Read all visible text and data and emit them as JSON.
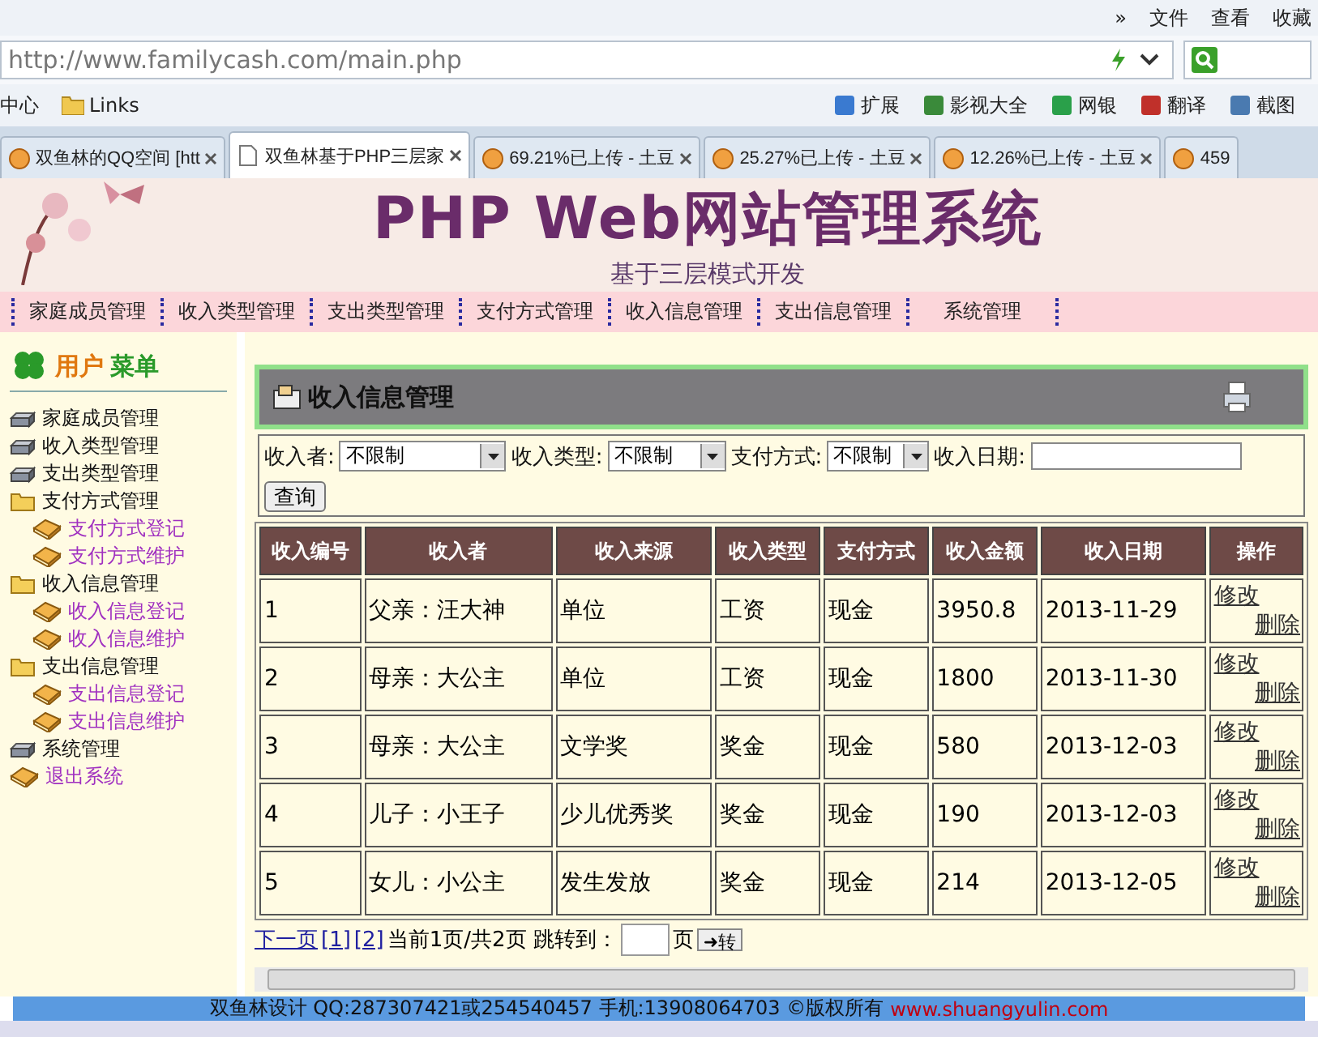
{
  "browser": {
    "menu": [
      "»",
      "文件",
      "查看",
      "收藏"
    ],
    "address": "http://www.familycash.com/main.php",
    "bookmarks_left": [
      "中心",
      "Links"
    ],
    "bookmarks_right": [
      "扩展",
      "影视大全",
      "网银",
      "翻译",
      "截图"
    ],
    "tabs": [
      {
        "label": "双鱼林的QQ空间 [htt",
        "selected": false
      },
      {
        "label": "双鱼林基于PHP三层家",
        "selected": true
      },
      {
        "label": "69.21%已上传 - 土豆",
        "selected": false
      },
      {
        "label": "25.27%已上传 - 土豆",
        "selected": false
      },
      {
        "label": "12.26%已上传 - 土豆",
        "selected": false
      },
      {
        "label": "459",
        "selected": false
      }
    ]
  },
  "header": {
    "title": "PHP Web网站管理系统",
    "subtitle": "基于三层模式开发"
  },
  "nav": [
    "家庭成员管理",
    "收入类型管理",
    "支出类型管理",
    "支付方式管理",
    "收入信息管理",
    "支出信息管理",
    "系统管理"
  ],
  "sidebar": {
    "title_first": "用户",
    "title_second": "菜单",
    "items": [
      {
        "kind": "module",
        "label": "家庭成员管理"
      },
      {
        "kind": "module",
        "label": "收入类型管理"
      },
      {
        "kind": "module",
        "label": "支出类型管理"
      },
      {
        "kind": "folder",
        "label": "支付方式管理",
        "children": [
          {
            "label": "支付方式登记"
          },
          {
            "label": "支付方式维护"
          }
        ]
      },
      {
        "kind": "folder",
        "label": "收入信息管理",
        "children": [
          {
            "label": "收入信息登记"
          },
          {
            "label": "收入信息维护"
          }
        ]
      },
      {
        "kind": "folder",
        "label": "支出信息管理",
        "children": [
          {
            "label": "支出信息登记"
          },
          {
            "label": "支出信息维护"
          }
        ]
      },
      {
        "kind": "module",
        "label": "系统管理"
      },
      {
        "kind": "exit",
        "label": "退出系统"
      }
    ]
  },
  "panel": {
    "title": "收入信息管理",
    "filters": [
      {
        "label": "收入者:",
        "kind": "select",
        "value": "不限制"
      },
      {
        "label": "收入类型:",
        "kind": "select",
        "value": "不限制"
      },
      {
        "label": "支付方式:",
        "kind": "select",
        "value": "不限制"
      },
      {
        "label": "收入日期:",
        "kind": "text"
      }
    ],
    "query_button": "查询",
    "table": {
      "columns": [
        "收入编号",
        "收入者",
        "收入来源",
        "收入类型",
        "支付方式",
        "收入金额",
        "收入日期",
        "操作"
      ],
      "rows": [
        {
          "cells": [
            "1",
            "父亲：汪大神",
            "单位",
            "工资",
            "现金",
            "3950.8",
            "2013-11-29"
          ],
          "actions": [
            "修改",
            "删除"
          ]
        },
        {
          "cells": [
            "2",
            "母亲：大公主",
            "单位",
            "工资",
            "现金",
            "1800",
            "2013-11-30"
          ],
          "actions": [
            "修改",
            "删除"
          ]
        },
        {
          "cells": [
            "3",
            "母亲：大公主",
            "文学奖",
            "奖金",
            "现金",
            "580",
            "2013-12-03"
          ],
          "actions": [
            "修改",
            "删除"
          ]
        },
        {
          "cells": [
            "4",
            "儿子：小王子",
            "少儿优秀奖",
            "奖金",
            "现金",
            "190",
            "2013-12-03"
          ],
          "actions": [
            "修改",
            "删除"
          ]
        },
        {
          "cells": [
            "5",
            "女儿：小公主",
            "发生发放",
            "奖金",
            "现金",
            "214",
            "2013-12-05"
          ],
          "actions": [
            "修改",
            "删除"
          ]
        }
      ]
    },
    "pager": {
      "next": "下一页",
      "pages": [
        "[1]",
        "[2]"
      ],
      "status": "当前1页/共2页 跳转到：",
      "unit": "页",
      "go": "➜转"
    }
  },
  "footer": {
    "text": "双鱼林设计 QQ:287307421或254540457 手机:13908064703 ©版权所有",
    "link": "www.shuangyulin.com"
  }
}
